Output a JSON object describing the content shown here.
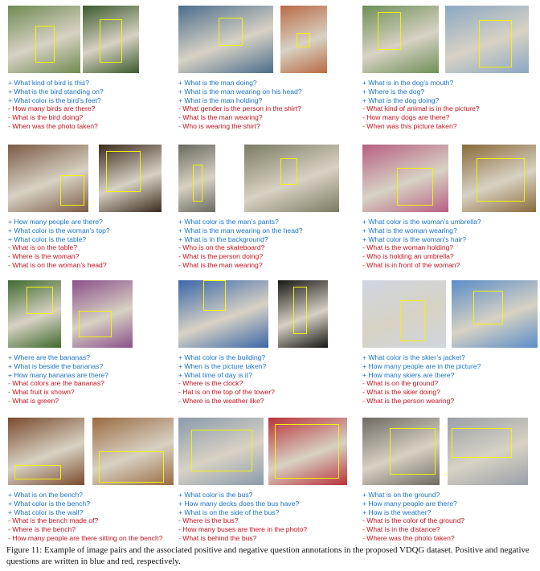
{
  "cells": [
    {
      "pos": [
        "+ What kind of bird is this?",
        "+ What is the bird standing on?",
        "+ What color is the bird’s feet?"
      ],
      "neg": [
        "- How many birds are there?",
        "- What is the bird doing?",
        "- When was the photo taken?"
      ],
      "colors": [
        "#6f8a52",
        "#3c5a2c"
      ]
    },
    {
      "pos": [
        "+ What is the man doing?",
        "+ What is the man wearing on his head?",
        "+ What is the man holding?"
      ],
      "neg": [
        "- What gender is the person in the shirt?",
        "- What is the man wearing?",
        "- Who is wearing the shirt?"
      ],
      "colors": [
        "#4b6d8d",
        "#b86a44"
      ]
    },
    {
      "pos": [
        "+ What is in the dog’s mouth?",
        "+ Where is the dog?",
        "+ What is the dog doing?"
      ],
      "neg": [
        "- What kind of animal is in the picture?",
        "- How many dogs are there?",
        "- When was this picture taken?"
      ],
      "colors": [
        "#6e8f58",
        "#8aa7c4"
      ]
    },
    {
      "pos": [
        "+ How many people are there?",
        "+ What color is the woman’s top?",
        "+ What color is the table?"
      ],
      "neg": [
        "- What is on the table?",
        "- Where is the woman?",
        "- What is on the woman’s head?"
      ],
      "colors": [
        "#7a5a44",
        "#3c2a1e"
      ]
    },
    {
      "pos": [
        "+ What color is the man’s pants?",
        "+ What is the man wearing on the head?",
        "+ What is in the background?"
      ],
      "neg": [
        "- Who is on the skateboard?",
        "- What is the person doing?",
        "- What is the man wearing?"
      ],
      "colors": [
        "#6a6a5e",
        "#7b7b62"
      ]
    },
    {
      "pos": [
        "+ What color is the woman’s umbrella?",
        "+ What is the woman wearing?",
        "+ What color is the woman’s hair?"
      ],
      "neg": [
        "- What is the woman holding?",
        "- Who is holding an umbrella?",
        "- What is in front of the woman?"
      ],
      "colors": [
        "#b65f82",
        "#8a6a3a"
      ]
    },
    {
      "pos": [
        "+ Where are the bananas?",
        "+ What is beside the bananas?",
        "+ How many bananas are there?"
      ],
      "neg": [
        "- What colors are the bananas?",
        "- What fruit is shown?",
        "- What is green?"
      ],
      "colors": [
        "#3f6a2e",
        "#8a4f8a"
      ]
    },
    {
      "pos": [
        "+ What color is the building?",
        "+ When is the picture taken?",
        "+ What time of day is it?"
      ],
      "neg": [
        "- Where is the clock?",
        "- Hat is on the top of the tower?",
        "- Where is the weather like?"
      ],
      "colors": [
        "#3a66a8",
        "#161616"
      ]
    },
    {
      "pos": [
        "+ What color is the skier’s jacket?",
        "+ How many people are in the picture?",
        "+ How many skiers are there?"
      ],
      "neg": [
        "- What is on the ground?",
        "- What is the skier doing?",
        "- What is the person wearing?"
      ],
      "colors": [
        "#cfd6e0",
        "#5a8cc8"
      ]
    },
    {
      "pos": [
        "+ What is on the bench?",
        "+ What color is the bench?",
        "+ What color is the wall?"
      ],
      "neg": [
        "- What is the bench made of?",
        "- Where is the bench?",
        "- How many people are there sitting on the bench?"
      ],
      "colors": [
        "#7a4a2c",
        "#9a6a42"
      ]
    },
    {
      "pos": [
        "+ What color is the bus?",
        "+ How many decks does the bus have?",
        "+ What is on the side of the bus?"
      ],
      "neg": [
        "- Where is the bus?",
        "- How many buses are there in the photo?",
        "- What is behind the bus?"
      ],
      "colors": [
        "#8a9aac",
        "#b8323a"
      ]
    },
    {
      "pos": [
        "+ What is on the ground?",
        "+ How many people are there?",
        "+ How is the weather?"
      ],
      "neg": [
        "- What is the color of the ground?",
        "- What is in the distance?",
        "- Where was the photo taken?"
      ],
      "colors": [
        "#6e6a62",
        "#9aa0a8"
      ]
    }
  ],
  "caption": "Figure 11: Example of image pairs and the associated positive and negative question annotations in the proposed VDQG dataset. Positive and negative questions are written in blue and red, respectively."
}
